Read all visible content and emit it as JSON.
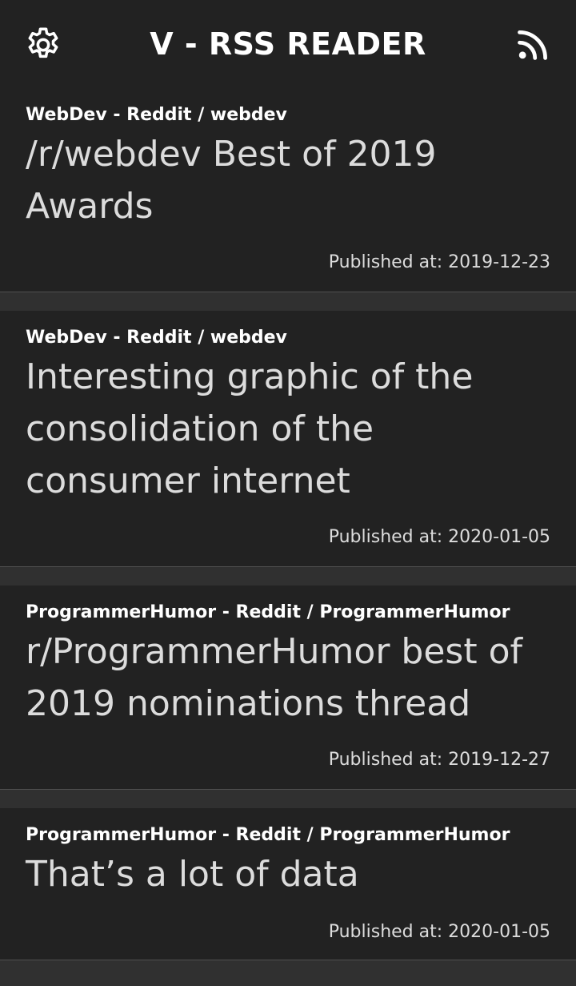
{
  "header": {
    "title": "V - RSS READER",
    "left_icon": "gear-icon",
    "right_icon": "rss-icon"
  },
  "colors": {
    "background": "#303030",
    "card": "#222222",
    "text": "#dcdcdc",
    "divider": "#505050"
  },
  "feed": {
    "items": [
      {
        "source": "WebDev - Reddit / webdev",
        "title": "/r/webdev Best of 2019 Awards",
        "published": "Published at: 2019-12-23"
      },
      {
        "source": "WebDev - Reddit / webdev",
        "title": "Interesting graphic of the consolidation of the consumer internet",
        "published": "Published at: 2020-01-05"
      },
      {
        "source": "ProgrammerHumor - Reddit / ProgrammerHumor",
        "title": "r/ProgrammerHumor best of 2019 nominations thread",
        "published": "Published at: 2019-12-27"
      },
      {
        "source": "ProgrammerHumor - Reddit / ProgrammerHumor",
        "title": "That’s a lot of data",
        "published": "Published at: 2020-01-05"
      }
    ]
  }
}
